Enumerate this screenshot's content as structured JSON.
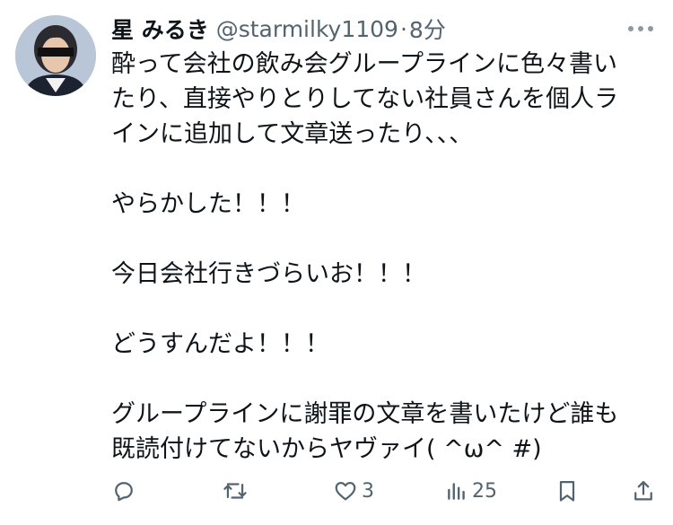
{
  "author": {
    "display_name": "星 みるき",
    "handle": "@starmilky1109",
    "separator": "·",
    "time": "8分"
  },
  "tweet": {
    "lines": [
      "酔って会社の飲み会グループラインに色々書い",
      "たり、直接やりとりしてない社員さんを個人ラ",
      "インに追加して文章送ったり、、、",
      "",
      "やらかした！！！",
      "",
      "今日会社行きづらいお！！！",
      "",
      "どうすんだよ！！！",
      "",
      "グループラインに謝罪の文章を書いたけど誰も",
      "既読付けてないからヤヴァイ( ^ω^ #)"
    ]
  },
  "actions": {
    "reply_count": "",
    "retweet_count": "",
    "like_count": "3",
    "views_count": "25"
  },
  "colors": {
    "text": "#0f1419",
    "secondary": "#536471",
    "background": "#ffffff"
  },
  "icons": {
    "more": "more-icon",
    "reply": "reply-icon",
    "retweet": "retweet-icon",
    "like": "heart-icon",
    "views": "analytics-icon",
    "bookmark": "bookmark-icon",
    "share": "share-icon"
  }
}
